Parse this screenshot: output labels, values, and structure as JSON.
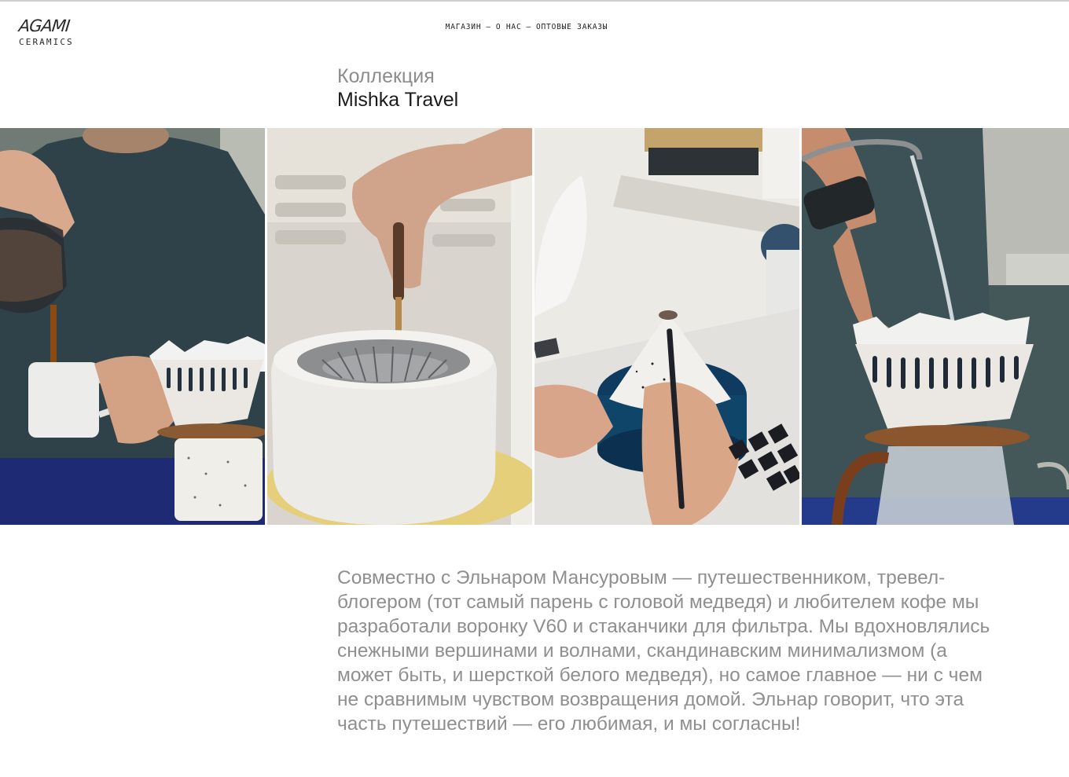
{
  "brand": {
    "logo_mark": "AGAMI",
    "logo_sub": "CERAMICS"
  },
  "nav": {
    "items": [
      "МАГАЗИН",
      "О НАС",
      "ОПТОВЫЕ ЗАКАЗЫ"
    ],
    "separator": "—"
  },
  "collection": {
    "label": "Коллекция",
    "name": "Mishka Travel"
  },
  "gallery": {
    "photos": [
      {
        "icon": "photo-pouring-coffee-into-mug"
      },
      {
        "icon": "photo-carving-ceramic-funnel"
      },
      {
        "icon": "photo-painting-ceramic-cone"
      },
      {
        "icon": "photo-pour-over-with-kettle"
      }
    ]
  },
  "description": "Совместно с Эльнаром Мансуровым — путешественником, тревел-блогером (тот самый парень с головой медведя) и любителем кофе мы разработали воронку V60 и стаканчики для фильтра. Мы вдохновлялись снежными вершинами и волнами, скандинавским минимализмом (а может быть, и шерсткой белого медведя), но самое главное — ни с чем не сравнимым чувством возвращения домой. Эльнар говорит, что эта часть путешествий — его любимая, и мы согласны!"
}
